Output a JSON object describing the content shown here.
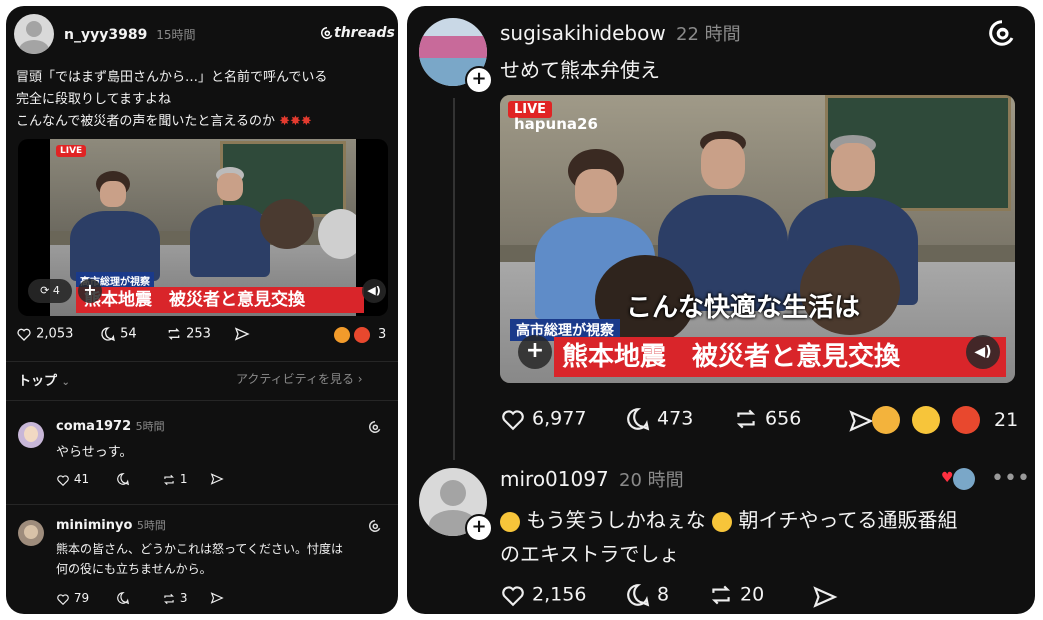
{
  "left": {
    "post": {
      "username": "n_yyy3989",
      "time": "15時間",
      "brand": "threads",
      "text_lines": [
        "冒頭「ではまず島田さんから…」と名前で呼んでいる",
        "完全に段取りしてますよね",
        "こんなんで被災者の声を聞いたと言えるのか"
      ],
      "video": {
        "live_label": "LIVE",
        "caption_tag": "高市総理が視察",
        "banner": "熊本地震　被災者と意見交換",
        "repost_count": "4"
      },
      "likes": "2,053",
      "comments": "54",
      "reposts": "253",
      "reactions_count": "3"
    },
    "sort": {
      "label": "トップ",
      "activity_link": "アクティビティを見る"
    },
    "replies": [
      {
        "username": "coma1972",
        "time": "5時間",
        "text": "やらせっす。",
        "likes": "41",
        "comments": "",
        "reposts": "1"
      },
      {
        "username": "miniminyo",
        "time": "5時間",
        "text_lines": [
          "熊本の皆さん、どうかこれは怒ってください。忖度は",
          "何の役にも立ちませんから。"
        ],
        "likes": "79",
        "comments": "",
        "reposts": "3"
      }
    ]
  },
  "right": {
    "post": {
      "username": "sugisakihidebow",
      "time": "22 時間",
      "text": "せめて熊本弁使え",
      "video": {
        "live_label": "LIVE",
        "channel": "hapuna26",
        "subtitle": "こんな快適な生活は",
        "caption_tag": "高市総理が視察",
        "banner": "熊本地震　被災者と意見交換"
      },
      "likes": "6,977",
      "comments": "473",
      "reposts": "656",
      "reactions_count": "21"
    },
    "reply": {
      "username": "miro01097",
      "time": "20 時間",
      "text_line1": "もう笑うしかねぇな",
      "text_line1b": "朝イチやってる通販番組",
      "text_line2": "のエキストラでしょ",
      "likes": "2,156",
      "comments": "8",
      "reposts": "20"
    }
  },
  "colors": {
    "panel_bg": "#101010",
    "text": "#f3f3f3",
    "muted": "#8a8a8a",
    "live_red": "#e02424",
    "banner_red": "#d9252a"
  },
  "icons": [
    "heart-icon",
    "comment-icon",
    "repost-icon",
    "share-icon",
    "threads-logo-icon",
    "chevron-down-icon",
    "chevron-right-icon",
    "more-icon",
    "volume-icon",
    "plus-icon",
    "anger-emoji-icon"
  ]
}
